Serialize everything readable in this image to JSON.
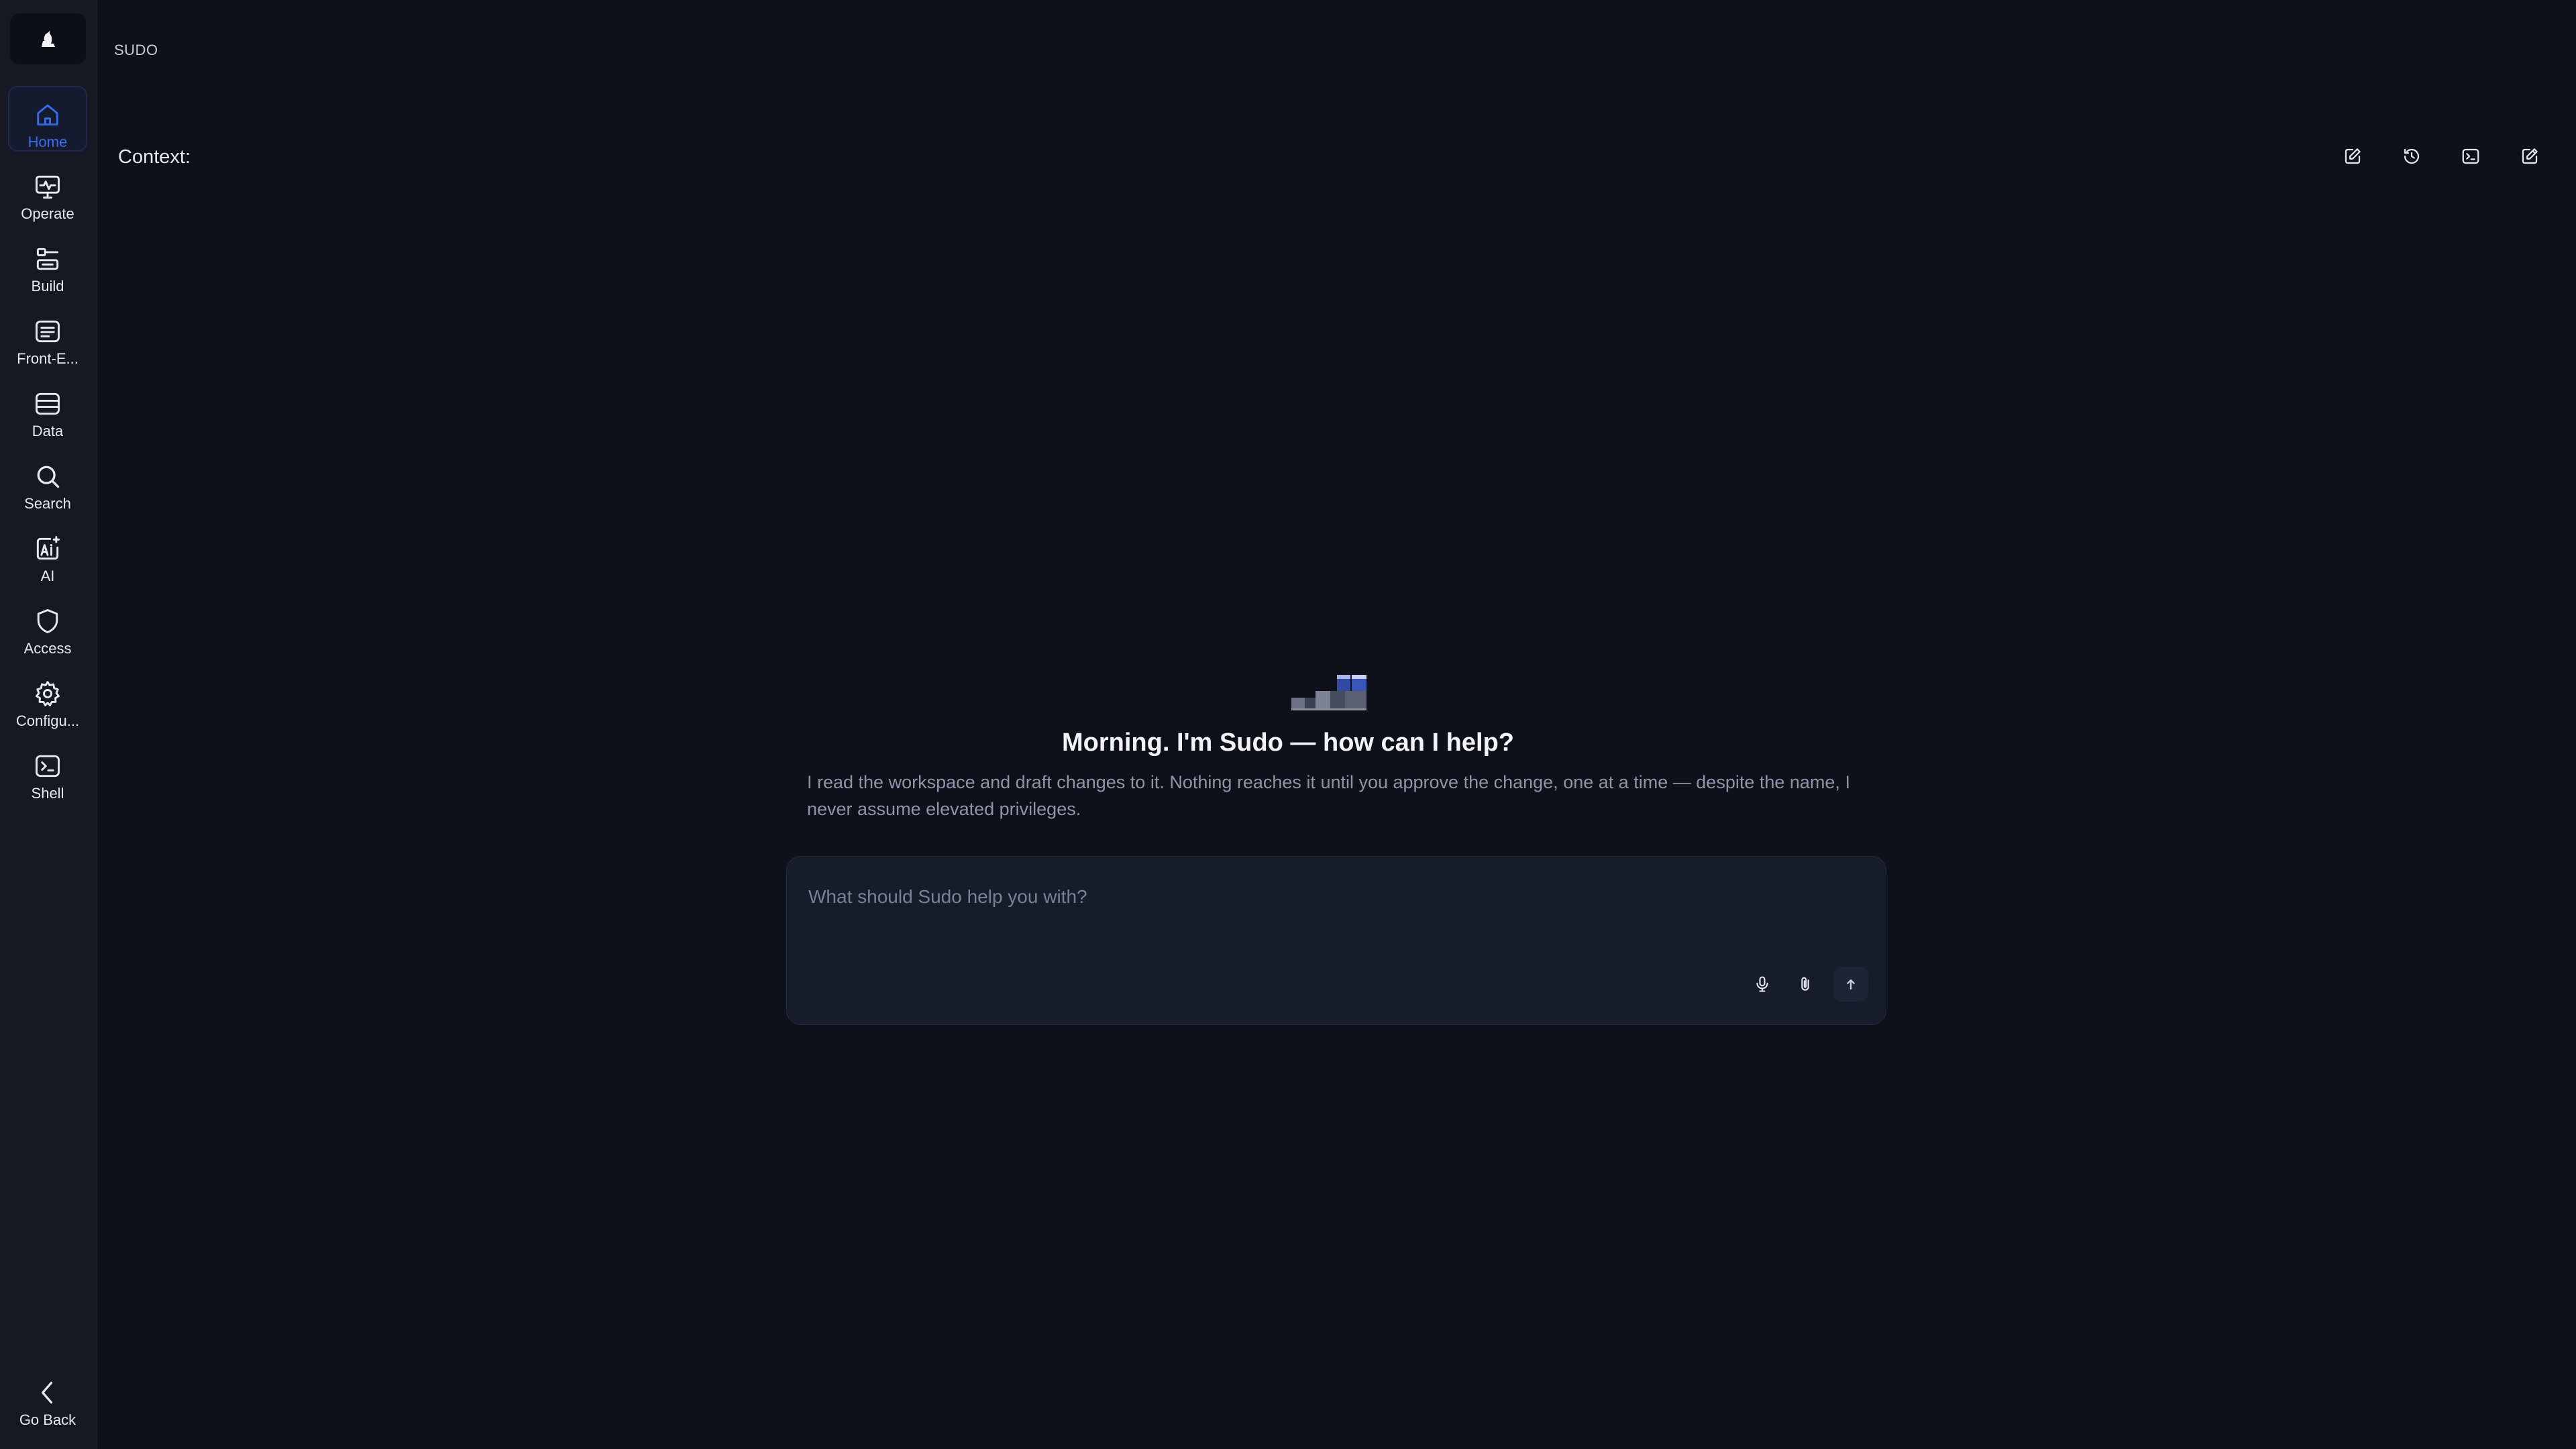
{
  "app": {
    "breadcrumb": "SUDO"
  },
  "sidebar": {
    "items": [
      {
        "label": "Home",
        "icon": "home-icon",
        "active": true
      },
      {
        "label": "Operate",
        "icon": "monitor-pulse-icon"
      },
      {
        "label": "Build",
        "icon": "build-icon"
      },
      {
        "label": "Front-E...",
        "icon": "front-end-icon"
      },
      {
        "label": "Data",
        "icon": "database-icon"
      },
      {
        "label": "Search",
        "icon": "search-icon"
      },
      {
        "label": "AI",
        "icon": "ai-sparkle-icon"
      },
      {
        "label": "Access",
        "icon": "shield-icon"
      },
      {
        "label": "Configu...",
        "icon": "gear-icon"
      },
      {
        "label": "Shell",
        "icon": "terminal-icon"
      }
    ],
    "go_back": "Go Back"
  },
  "context": {
    "label": "Context:"
  },
  "toolbar": {
    "icons": [
      "edit-icon",
      "history-icon",
      "terminal-icon",
      "new-chat-icon"
    ]
  },
  "hero": {
    "title": "Morning. I'm Sudo — how can I help?",
    "subtitle": "I read the workspace and draft changes to it. Nothing reaches it until you approve the change, one at a time — despite the name, I never assume elevated privileges."
  },
  "composer": {
    "placeholder": "What should Sudo help you with?",
    "value": ""
  },
  "colors": {
    "background": "#0f111a",
    "sidebar": "#161922",
    "accent": "#3b6cf0",
    "composer": "#171c2a"
  }
}
